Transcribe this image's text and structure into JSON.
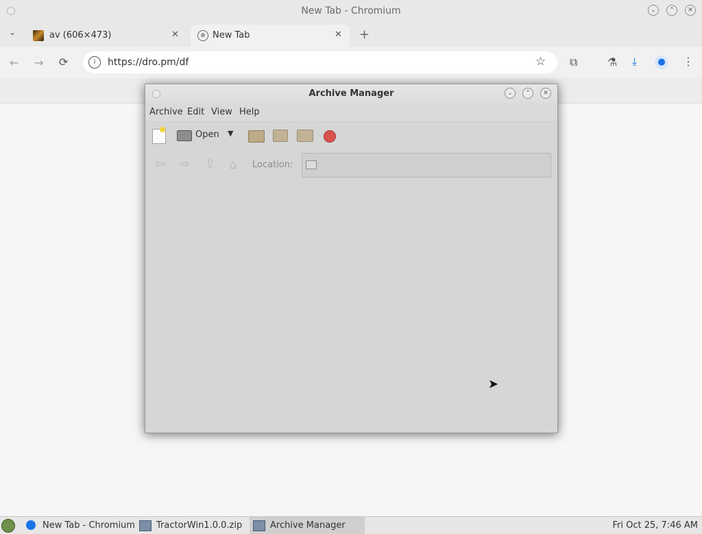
{
  "browser": {
    "window_title": "New Tab - Chromium",
    "tabs": [
      {
        "label": "av (606×473)"
      },
      {
        "label": "New Tab"
      }
    ],
    "url": "https://dro.pm/df"
  },
  "archive_manager": {
    "title": "Archive Manager",
    "menu": [
      "Archive",
      "Edit",
      "View",
      "Help"
    ],
    "toolbar": {
      "open_label": "Open"
    },
    "location_label": "Location:",
    "location_value": ""
  },
  "taskbar": {
    "items": [
      {
        "label": "New Tab - Chromium"
      },
      {
        "label": "TractorWin1.0.0.zip"
      },
      {
        "label": "Archive Manager"
      }
    ],
    "clock": "Fri Oct 25,  7:46 AM"
  },
  "colors": {
    "page_bg": "#f6f6f6",
    "window_bg": "#d6d6d6",
    "record_button": "#d9534f",
    "profile_blue": "#1a73e8"
  }
}
